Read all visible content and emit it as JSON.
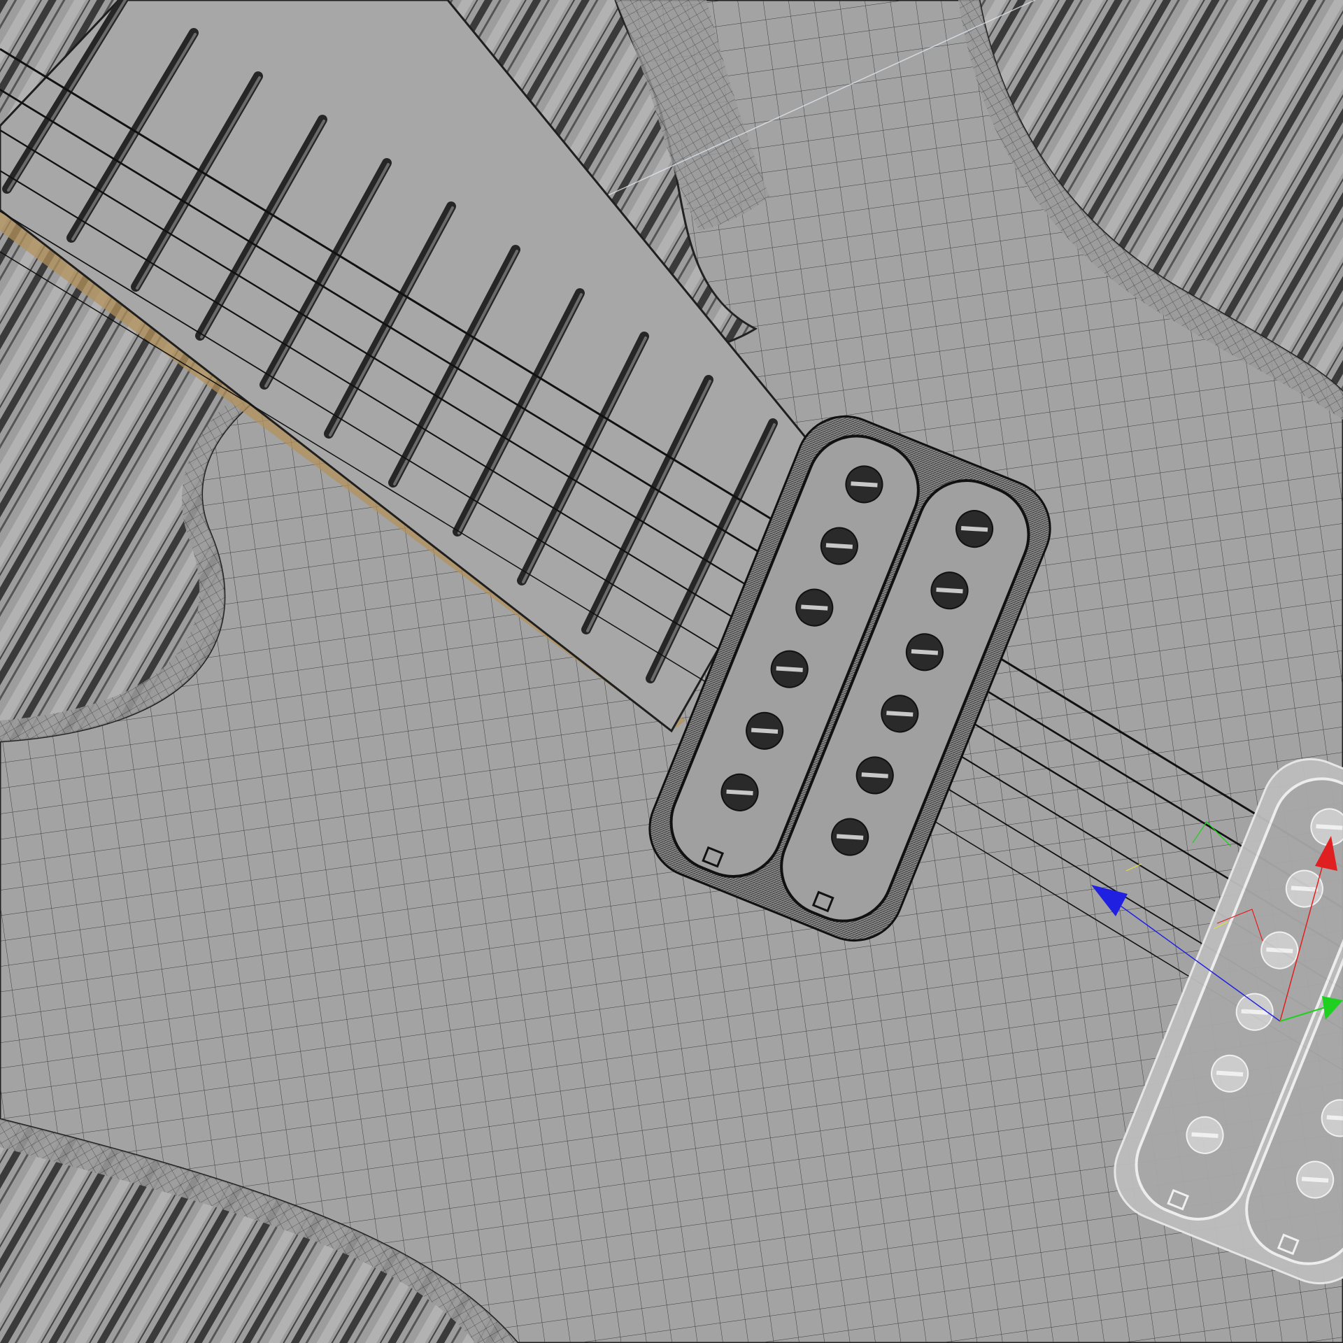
{
  "viewport": {
    "mode": "wireframe-on-shaded",
    "subject": "guitar-body-neck-pickups"
  },
  "colors": {
    "background": "#9a9a9a",
    "surface": "#a3a3a3",
    "wire": "#2b2b2b",
    "wood_accent": "#b4925a",
    "gizmo_x": "#e02020",
    "gizmo_y": "#20d020",
    "gizmo_z": "#2020e0",
    "highlight_line": "#dfe7ee"
  },
  "scene": {
    "fret_count": 11,
    "string_count": 6,
    "pickups": [
      {
        "name": "neck-humbucker",
        "pole_pieces": 12,
        "selected": false
      },
      {
        "name": "bridge-humbucker",
        "pole_pieces": 12,
        "selected": true
      }
    ]
  },
  "gizmo": {
    "type": "translate",
    "axes": [
      "x",
      "y",
      "z"
    ],
    "icons": [
      "x-axis-arrow-icon",
      "y-axis-arrow-icon",
      "z-axis-arrow-icon"
    ]
  }
}
